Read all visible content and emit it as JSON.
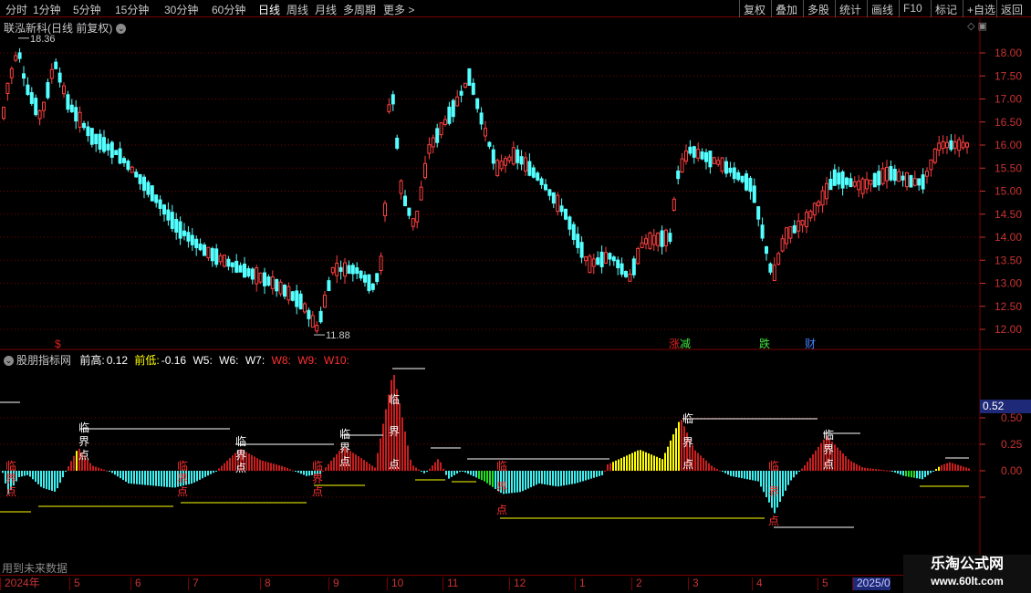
{
  "toolbar": {
    "periods": [
      "分时",
      "1分钟",
      "5分钟",
      "15分钟",
      "30分钟",
      "60分钟",
      "日线",
      "周线",
      "月线",
      "多周期",
      "更多 >"
    ],
    "active_period": "日线",
    "actions": [
      "复权",
      "叠加",
      "多股",
      "统计",
      "画线",
      "F10",
      "+自选",
      "标记",
      "返回"
    ]
  },
  "stock": {
    "title": "联泓新科(日线 前复权)",
    "high_label": "18.36",
    "low_label": "11.88"
  },
  "price_axis": {
    "ticks": [
      "18.00",
      "17.50",
      "17.00",
      "16.50",
      "16.00",
      "15.50",
      "15.00",
      "14.50",
      "14.00",
      "13.50",
      "13.00",
      "12.50",
      "12.00"
    ]
  },
  "events": [
    {
      "label": "$",
      "color": "#e02020"
    },
    {
      "label": "涨",
      "color": "#e02020"
    },
    {
      "label": "减",
      "color": "#40e040"
    },
    {
      "label": "跌",
      "color": "#40e040"
    },
    {
      "label": "财",
      "color": "#4080ff"
    }
  ],
  "indicator": {
    "name": "股朋指标网",
    "qiangao_label": "前高:",
    "qiangao_value": "0.12",
    "qiandi_label": "前低:",
    "qiandi_value": "-0.16",
    "w5": "W5:",
    "w6": "W6:",
    "w7": "W7:",
    "w8": "W8:",
    "w9": "W9:",
    "w10": "W10:",
    "axis_ticks": [
      "0.50",
      "0.25",
      "0.00",
      "-0.25"
    ],
    "current_value": "0.52",
    "point_labels": [
      "临",
      "界",
      "点"
    ]
  },
  "date_axis": {
    "labels": [
      "2024年",
      "5",
      "6",
      "7",
      "8",
      "9",
      "10",
      "11",
      "12",
      "1",
      "2",
      "3",
      "4",
      "5",
      "2025/0"
    ],
    "selected": "2025/0"
  },
  "footer": {
    "future_note": "用到未来数据"
  },
  "watermark": {
    "line1": "乐淘公式网",
    "line2": "www.60lt.com"
  },
  "colors": {
    "up": "#ff4040",
    "down": "#54ffff",
    "grid": "#7a0000",
    "indicator_red": "#c81e1e",
    "indicator_cyan": "#40f0f0",
    "indicator_yellow": "#ffff00",
    "indicator_green": "#20e020"
  }
}
